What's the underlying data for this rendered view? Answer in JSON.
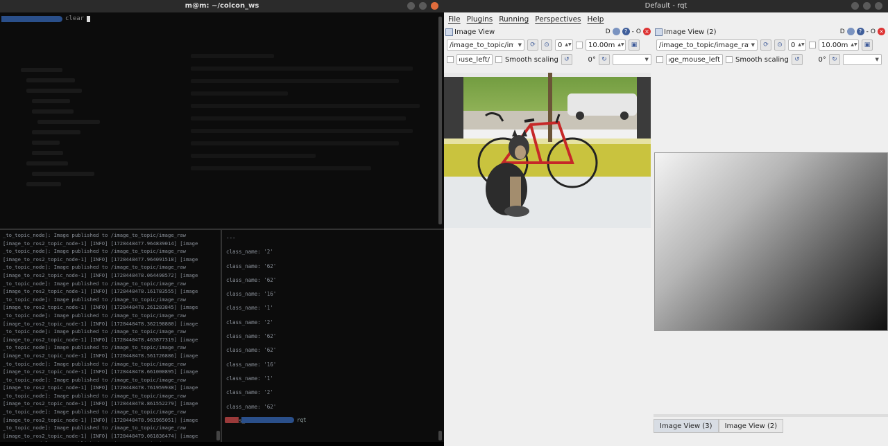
{
  "terminal": {
    "title": "m@m: ~/colcon_ws",
    "top_prompt_cmd": "clear",
    "log_lines": [
      "_to_topic_node]: Image published to /image_to_topic/image_raw",
      "[image_to_ros2_topic_node-1] [INFO] [1728448477.964839014] [image",
      "_to_topic_node]: Image published to /image_to_topic/image_raw",
      "[image_to_ros2_topic_node-1] [INFO] [1728448477.964091518] [image",
      "_to_topic_node]: Image published to /image_to_topic/image_raw",
      "[image_to_ros2_topic_node-1] [INFO] [1728448478.064498572] [image",
      "_to_topic_node]: Image published to /image_to_topic/image_raw",
      "[image_to_ros2_topic_node-1] [INFO] [1728448478.161783555] [image",
      "_to_topic_node]: Image published to /image_to_topic/image_raw",
      "[image_to_ros2_topic_node-1] [INFO] [1728448478.261283845] [image",
      "_to_topic_node]: Image published to /image_to_topic/image_raw",
      "[image_to_ros2_topic_node-1] [INFO] [1728448478.362198880] [image",
      "_to_topic_node]: Image published to /image_to_topic/image_raw",
      "[image_to_ros2_topic_node-1] [INFO] [1728448478.463877319] [image",
      "_to_topic_node]: Image published to /image_to_topic/image_raw",
      "[image_to_ros2_topic_node-1] [INFO] [1728448478.561726886] [image",
      "_to_topic_node]: Image published to /image_to_topic/image_raw",
      "[image_to_ros2_topic_node-1] [INFO] [1728448478.661000895] [image",
      "_to_topic_node]: Image published to /image_to_topic/image_raw",
      "[image_to_ros2_topic_node-1] [INFO] [1728448478.761959938] [image",
      "_to_topic_node]: Image published to /image_to_topic/image_raw",
      "[image_to_ros2_topic_node-1] [INFO] [1728448478.861552279] [image",
      "_to_topic_node]: Image published to /image_to_topic/image_raw",
      "[image_to_ros2_topic_node-1] [INFO] [1728448478.961965051] [image",
      "_to_topic_node]: Image published to /image_to_topic/image_raw",
      "[image_to_ros2_topic_node-1] [INFO] [1728448479.061836474] [image",
      "_to_topic_node]: Image published to /image_to_topic/image_raw"
    ],
    "class_lines": [
      "---",
      "class_name: '2'",
      "class_name: '62'",
      "class_name: '62'",
      "class_name: '16'",
      "class_name: '1'",
      "class_name: '2'",
      "class_name: '62'",
      "class_name: '62'",
      "class_name: '16'",
      "class_name: '1'",
      "class_name: '2'",
      "class_name: '62'",
      "class_name: '62'"
    ],
    "bottom_prompt_cmd": "rqt"
  },
  "rqt": {
    "title": "Default - rqt",
    "menu": [
      "File",
      "Plugins",
      "Running",
      "Perspectives",
      "Help"
    ],
    "plugin1": {
      "title": "Image View",
      "right_label": "D",
      "topic": "/image_to_topic/image_raw",
      "spin_value": "0",
      "time_value": "10.00m",
      "mouse_field": "/image_mouse_left",
      "smooth_label": "Smooth scaling",
      "rotation": "0°"
    },
    "plugin2": {
      "title": "Image View (2)",
      "right_label": "D",
      "topic": "/image_to_topic/image_raw/",
      "spin_value": "0",
      "time_value": "10.00m",
      "mouse_field": "image_mouse_left",
      "smooth_label": "Smooth scaling",
      "rotation": "0°"
    },
    "tabs": [
      "Image View (3)",
      "Image View (2)"
    ]
  },
  "colors": {
    "terminal_bg": "#0c0c0c",
    "prompt_blue": "#2a4f8a",
    "rqt_bg": "#efefef",
    "close_red": "#dd3333"
  }
}
